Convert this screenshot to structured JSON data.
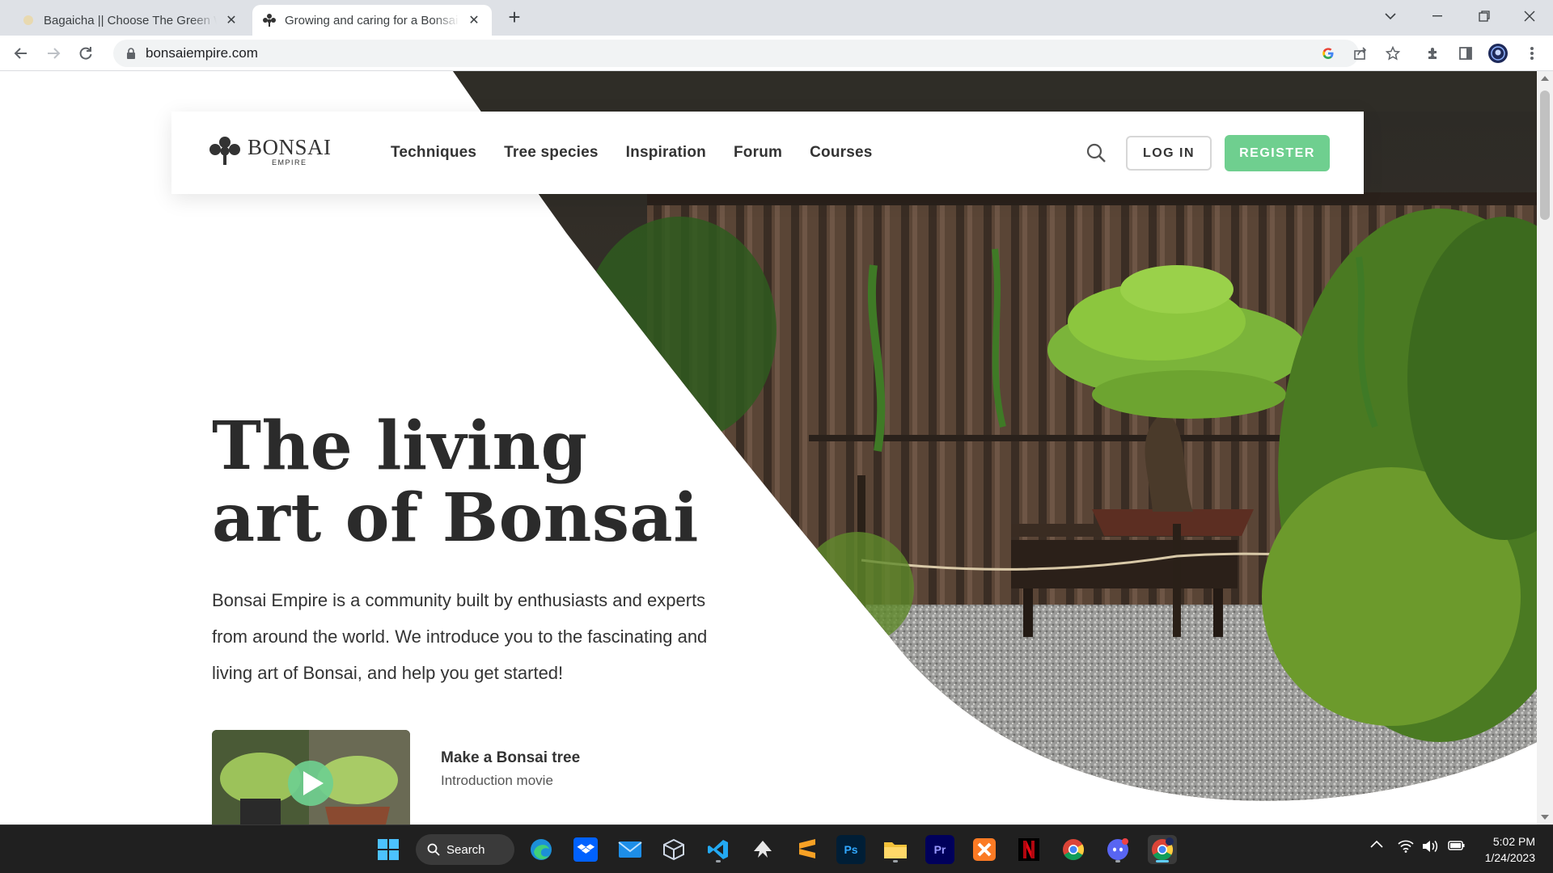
{
  "browser": {
    "tabs": [
      {
        "title": "Bagaicha || Choose The Green Way",
        "active": false
      },
      {
        "title": "Growing and caring for a Bonsai Tree",
        "active": true
      }
    ],
    "new_tab_label": "+",
    "address": "bonsaiempire.com"
  },
  "site": {
    "logo": {
      "name": "BONSAI",
      "sub": "EMPIRE"
    },
    "menu": [
      "Techniques",
      "Tree species",
      "Inspiration",
      "Forum",
      "Courses"
    ],
    "login_label": "LOG IN",
    "register_label": "REGISTER",
    "accent_color": "#6fcf8f"
  },
  "hero": {
    "headline_line1": "The living",
    "headline_line2": "art of Bonsai",
    "lead": "Bonsai Empire is a community built by enthusiasts and experts from around the world. We introduce you to the fascinating and living art of Bonsai, and help you get started!",
    "video": {
      "title": "Make a Bonsai tree",
      "subtitle": "Introduction movie"
    }
  },
  "taskbar": {
    "search_label": "Search",
    "apps": [
      "windows-start",
      "search",
      "edge",
      "dropbox",
      "mail",
      "virtualbox",
      "vscode",
      "inkscape",
      "sublime-text",
      "photoshop",
      "file-explorer",
      "premiere-pro",
      "xampp",
      "netflix",
      "chrome",
      "discord",
      "chrome-profile"
    ],
    "time": "5:02 PM",
    "date": "1/24/2023"
  }
}
